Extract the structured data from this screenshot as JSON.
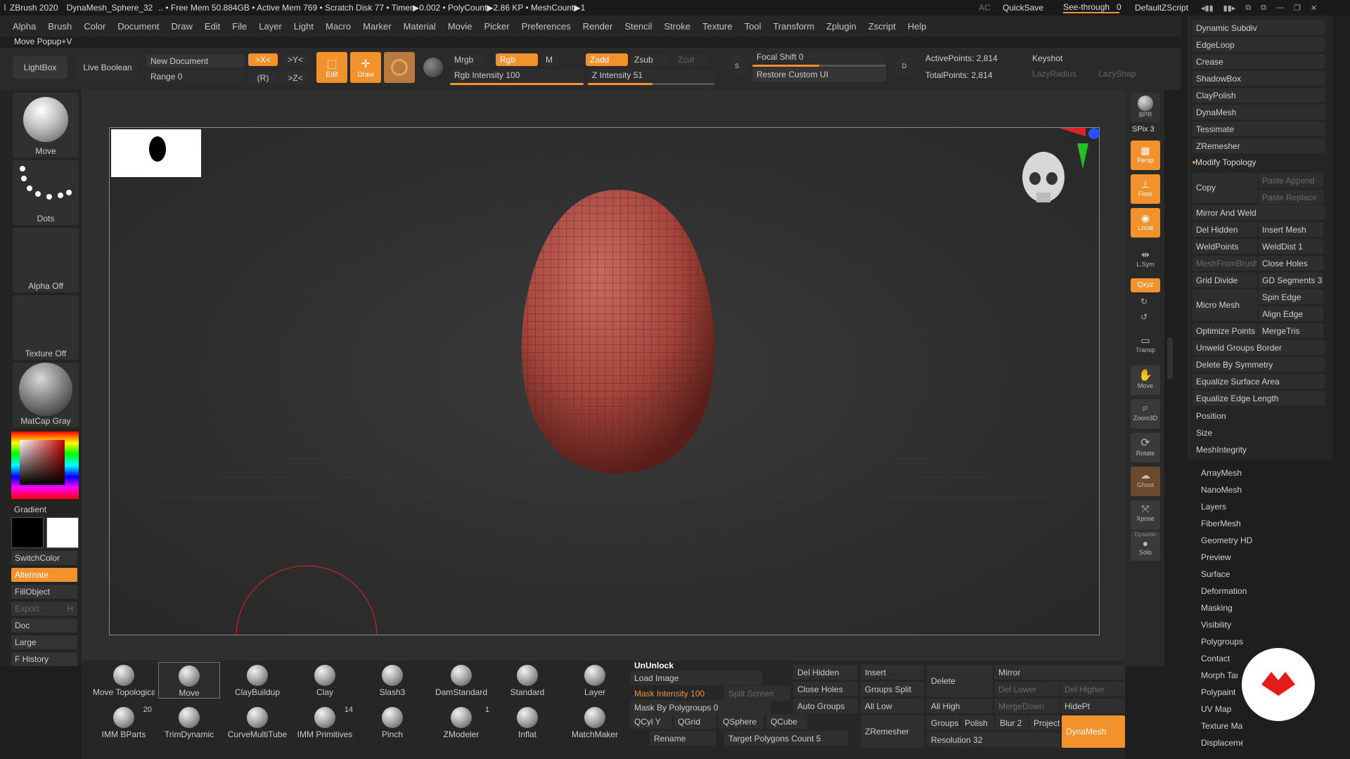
{
  "titlebar": {
    "app": "ZBrush 2020",
    "doc": "DynaMesh_Sphere_32",
    "stats": ".. • Free Mem 50.884GB • Active Mem 769 • Scratch Disk 77 • Timer▶0.002 • PolyCount▶2.86 KP • MeshCount▶1",
    "ac": "AC",
    "quicksave": "QuickSave",
    "seethrough": "See-through",
    "seethrough_val": "0",
    "script": "DefaultZScript"
  },
  "menu": [
    "Alpha",
    "Brush",
    "Color",
    "Document",
    "Draw",
    "Edit",
    "File",
    "Layer",
    "Light",
    "Macro",
    "Marker",
    "Material",
    "Movie",
    "Picker",
    "Preferences",
    "Render",
    "Stencil",
    "Stroke",
    "Texture",
    "Tool",
    "Transform",
    "Zplugin",
    "Zscript",
    "Help"
  ],
  "popup_label": "Move Popup+V",
  "toolbar": {
    "lightbox": "LightBox",
    "live_boolean": "Live Boolean",
    "new_document": "New Document",
    "range": "Range 0",
    "x_sym": ">X<",
    "y_sym": ">Y<",
    "z_sym": ">Z<",
    "r": "(R)",
    "edit": "Edit",
    "draw": "Draw",
    "mrgb": "Mrgb",
    "rgb": "Rgb",
    "m": "M",
    "rgb_intensity": "Rgb Intensity 100",
    "zadd": "Zadd",
    "zsub": "Zsub",
    "zcut": "Zcut",
    "z_intensity": "Z Intensity 51",
    "focal_shift": "Focal Shift 0",
    "restore_ui": "Restore Custom UI",
    "active_points": "ActivePoints: 2,814",
    "total_points": "TotalPoints: 2,814",
    "keyshot": "Keyshot",
    "lazy_radius": "LazyRadius",
    "lazy_snap": "LazySnap",
    "s": "S",
    "d": "D"
  },
  "left": {
    "brush_label": "Move",
    "stroke_label": "Dots",
    "alpha_label": "Alpha Off",
    "texture_label": "Texture Off",
    "material_label": "MatCap Gray",
    "gradient": "Gradient",
    "switchcolor": "SwitchColor",
    "alternate": "Alternate",
    "fillobject": "FillObject",
    "export": "Export",
    "export_key": "H",
    "doc": "Doc",
    "large": "Large",
    "fhistory": "F History"
  },
  "rightshelf": {
    "bpr": "BPR",
    "spix": "SPix 3",
    "persp": "Persp",
    "floor": "Floor",
    "local": "Local",
    "lsym": "L.Sym",
    "xyz": "Qxyz",
    "transp": "Transp",
    "move": "Move",
    "zoom": "Zoom3D",
    "rotate": "Rotate",
    "ghost": "Ghost",
    "xpose": "Xpose",
    "dynamic": "Dynamic",
    "solo": "Solo"
  },
  "palette": {
    "items": [
      "Dynamic Subdiv",
      "EdgeLoop",
      "Crease",
      "ShadowBox",
      "ClayPolish",
      "DynaMesh",
      "Tessimate",
      "ZRemesher"
    ],
    "modify_topology": "Modify Topology",
    "copy": "Copy",
    "paste_append": "Paste Append",
    "paste_replace": "Paste Replace",
    "mirror_weld": "Mirror And Weld",
    "del_hidden": "Del Hidden",
    "insert_mesh": "Insert Mesh",
    "weld_points": "WeldPoints",
    "weld_dist": "WeldDist 1",
    "mesh_from_brush": "MeshFromBrush",
    "close_holes": "Close Holes",
    "grid_divide": "Grid Divide",
    "gd_segments": "GD Segments 3",
    "micro_mesh": "Micro Mesh",
    "spin_edge": "Spin Edge",
    "align_edge": "Align Edge",
    "optimize_points": "Optimize Points",
    "merge_tris": "MergeTris",
    "unweld": "Unweld Groups Border",
    "delete_sym": "Delete By Symmetry",
    "eq_area": "Equalize Surface Area",
    "eq_edge": "Equalize Edge Length",
    "position": "Position",
    "size": "Size",
    "mesh_integrity": "MeshIntegrity",
    "sections": [
      "ArrayMesh",
      "NanoMesh",
      "Layers",
      "FiberMesh",
      "Geometry HD",
      "Preview",
      "Surface",
      "Deformation",
      "Masking",
      "Visibility",
      "Polygroups",
      "Contact",
      "Morph Target",
      "Polypaint",
      "UV Map",
      "Texture Map",
      "Displacement Map"
    ]
  },
  "brushes_row1": [
    {
      "name": "Move Topological"
    },
    {
      "name": "Move"
    },
    {
      "name": "ClayBuildup"
    },
    {
      "name": "Clay"
    },
    {
      "name": "Slash3"
    },
    {
      "name": "DamStandard"
    },
    {
      "name": "Standard"
    },
    {
      "name": "Layer"
    }
  ],
  "brushes_row2": [
    {
      "name": "IMM BParts",
      "count": "20"
    },
    {
      "name": "TrimDynamic",
      "count": ""
    },
    {
      "name": "CurveMultiTube",
      "count": ""
    },
    {
      "name": "IMM Primitives",
      "count": "14"
    },
    {
      "name": "Pinch",
      "count": ""
    },
    {
      "name": "ZModeler",
      "count": "1"
    },
    {
      "name": "Inflat",
      "count": ""
    },
    {
      "name": "MatchMaker",
      "count": ""
    }
  ],
  "bottom": {
    "unlock": "UnUnlock",
    "load_image": "Load Image",
    "mask_intensity": "Mask Intensity 100",
    "split_screen": "Split Screen",
    "mask_by_polygroups": "Mask By Polygroups 0",
    "qcyl": "QCyl Y",
    "qgrid": "QGrid",
    "qsphere": "QSphere",
    "qcube": "QCube",
    "rename": "Rename",
    "target_polys": "Target Polygons Count 5",
    "del_hidden": "Del Hidden",
    "insert": "Insert",
    "delete": "Delete",
    "mirror": "Mirror",
    "close_holes": "Close Holes",
    "groups_split": "Groups Split",
    "del_lower": "Del Lower",
    "del_higher": "Del Higher",
    "auto_groups": "Auto Groups",
    "all_low": "All Low",
    "all_high": "All High",
    "merge_down": "MergeDown",
    "hide_pt": "HidePt",
    "zremesher": "ZRemesher",
    "groups": "Groups",
    "polish": "Polish",
    "blur": "Blur 2",
    "project": "Project",
    "resolution": "Resolution 32",
    "dynamesh": "DynaMesh"
  }
}
